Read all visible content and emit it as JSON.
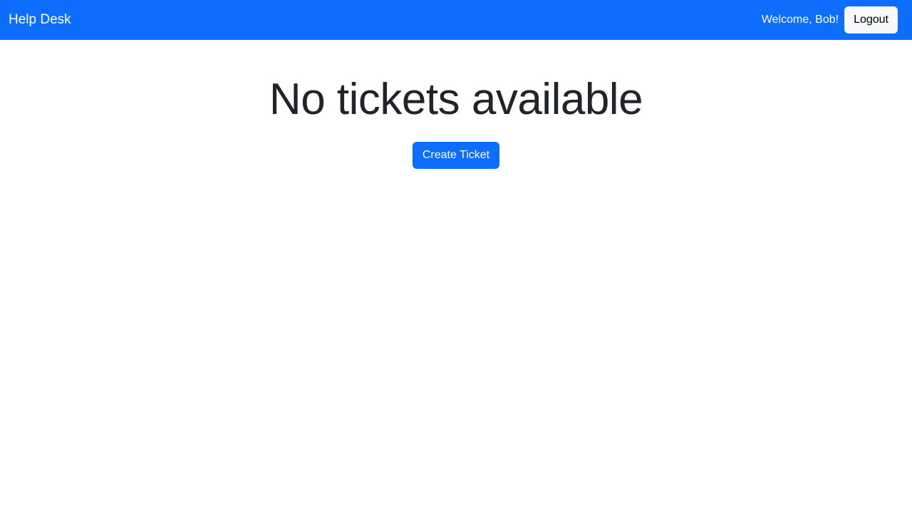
{
  "navbar": {
    "brand": "Help Desk",
    "welcome_text": "Welcome, Bob!",
    "logout_label": "Logout",
    "background_color": "#0d6efd"
  },
  "main": {
    "empty_message": "No tickets available",
    "create_ticket_label": "Create Ticket"
  }
}
